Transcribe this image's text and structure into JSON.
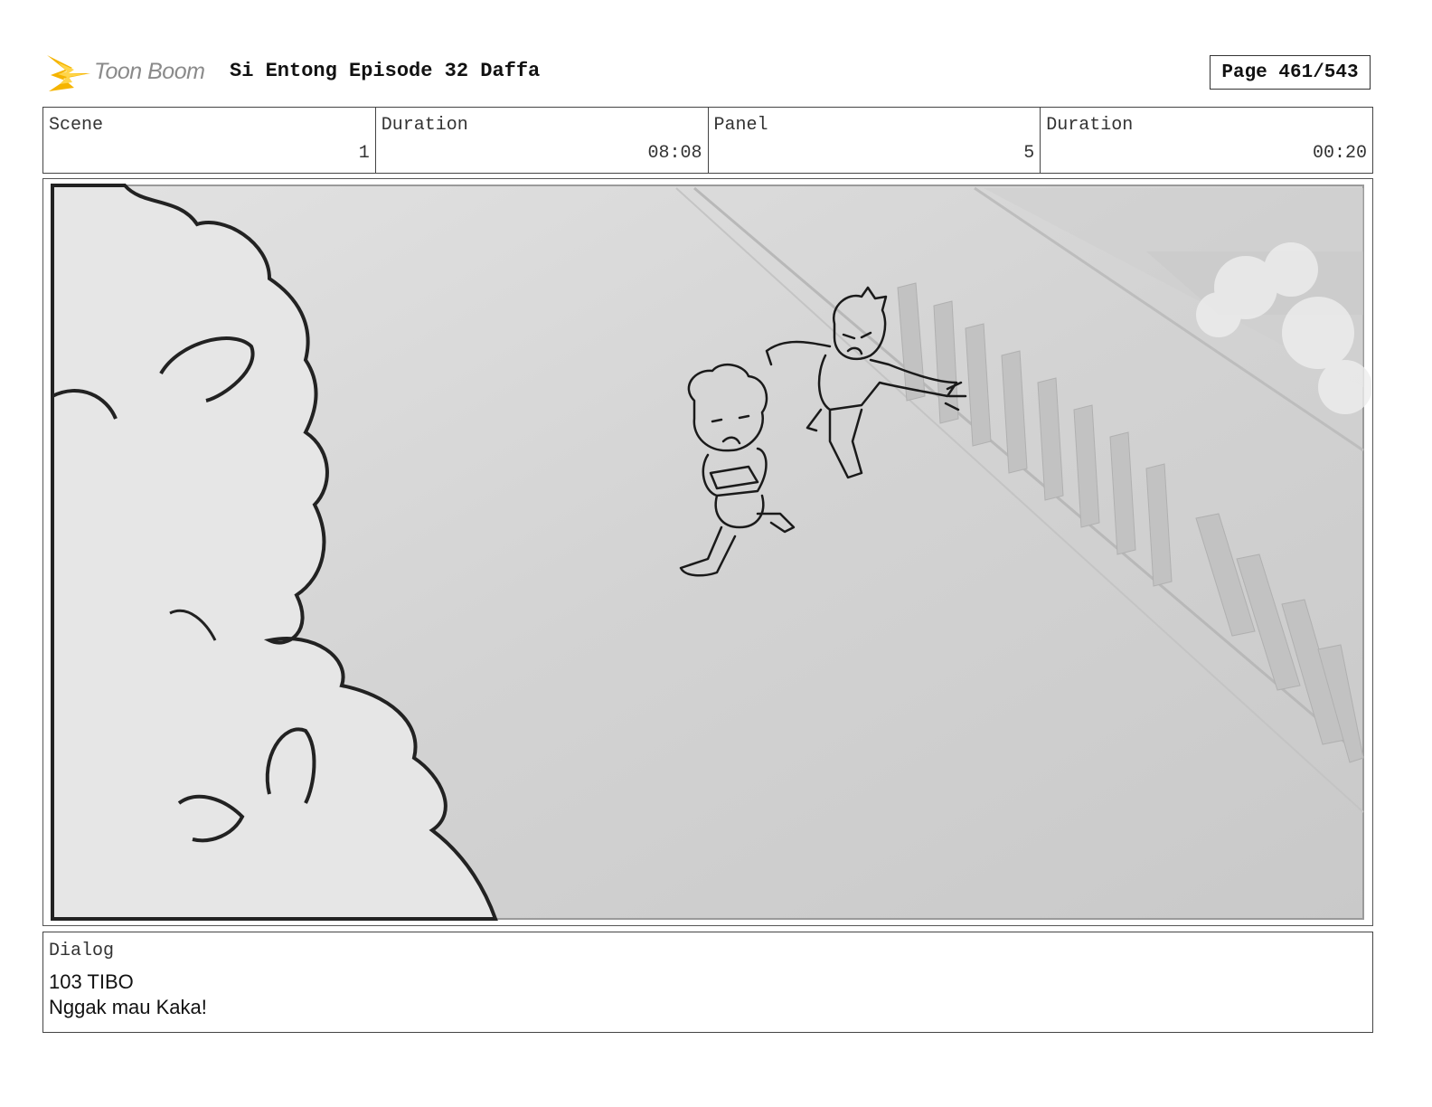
{
  "header": {
    "logo_text": "Toon Boom",
    "title": "Si Entong Episode 32 Daffa",
    "page": "Page 461/543"
  },
  "info": {
    "scene_label": "Scene",
    "scene_value": "1",
    "scene_duration_label": "Duration",
    "scene_duration_value": "08:08",
    "panel_label": "Panel",
    "panel_value": "5",
    "panel_duration_label": "Duration",
    "panel_duration_value": "00:20"
  },
  "dialog": {
    "label": "Dialog",
    "lines": [
      "103 TIBO",
      "Nggak mau Kaka!"
    ]
  },
  "colors": {
    "logo_accent": "#f5b400",
    "sketch_line": "#1a1a1a",
    "background_gray": "#d2d2d2"
  }
}
